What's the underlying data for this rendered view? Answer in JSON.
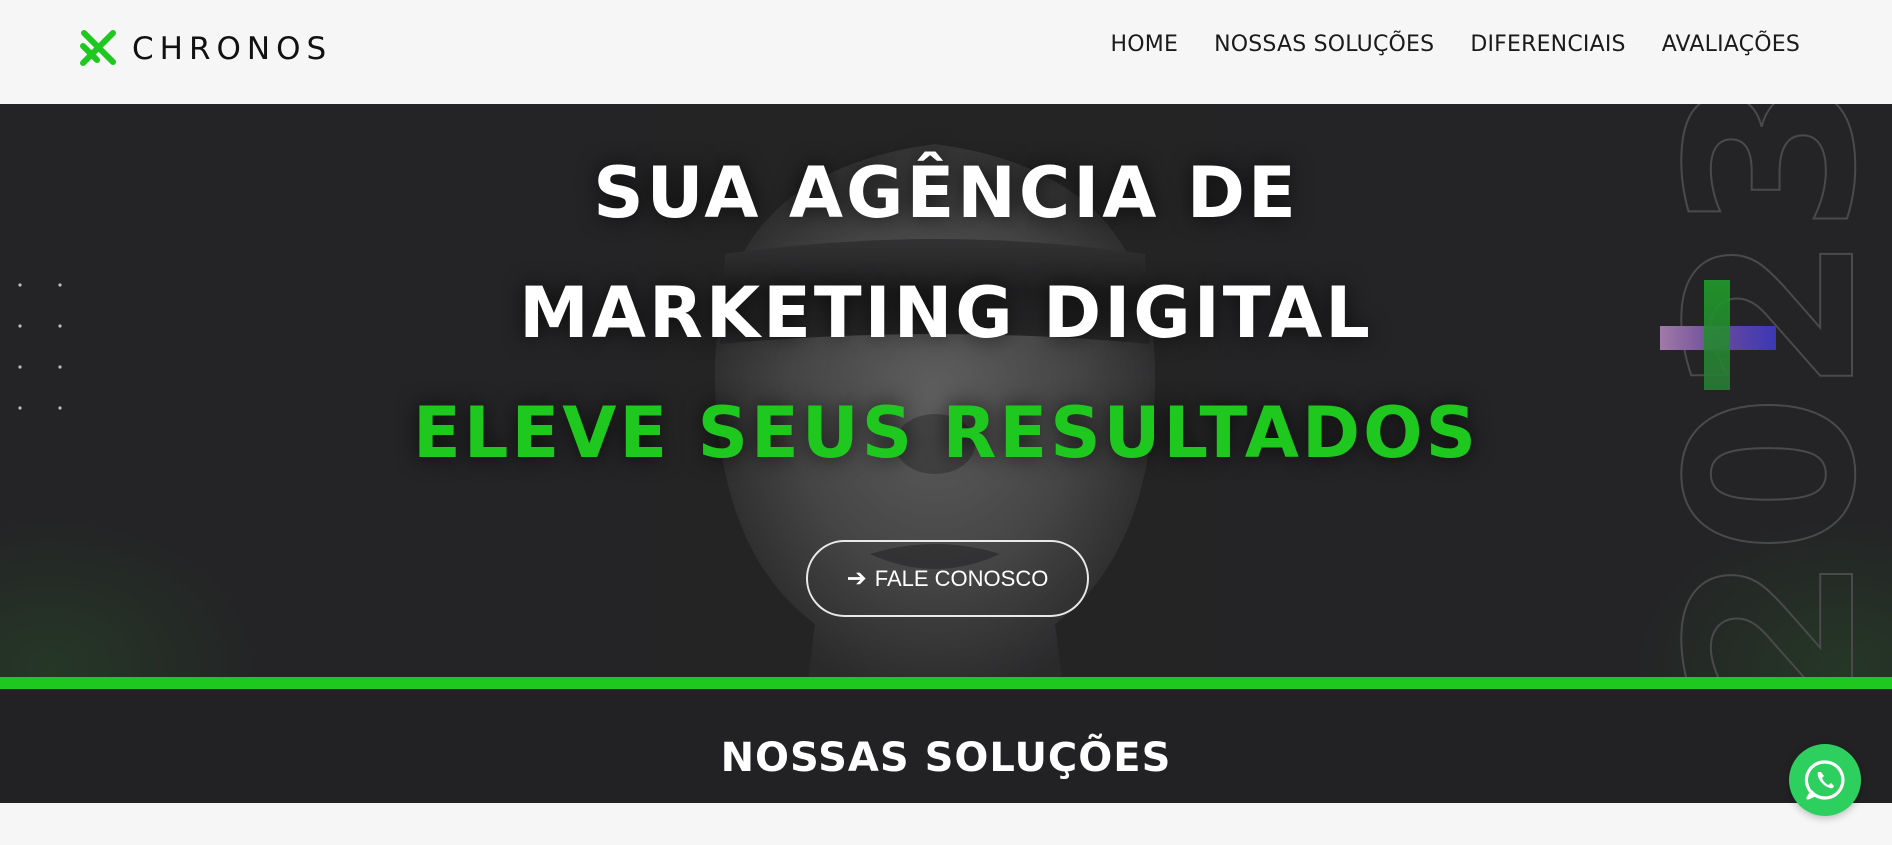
{
  "brand": {
    "name": "CHRONOS",
    "accent": "#1fc81f",
    "logo_icon": "chronos-logo-icon"
  },
  "nav": {
    "items": [
      "HOME",
      "NOSSAS SOLUÇÕES",
      "DIFERENCIAIS",
      "AVALIAÇÕES"
    ]
  },
  "hero": {
    "line1": "SUA AGÊNCIA DE",
    "line2": "MARKETING DIGITAL",
    "line3": "ELEVE SEUS RESULTADOS",
    "cta_label": "FALE CONOSCO",
    "cta_icon": "arrow-right-icon",
    "year_text": "2023",
    "background": "#242426"
  },
  "solutions": {
    "title": "NOSSAS SOLUÇÕES"
  },
  "floating": {
    "whatsapp_icon": "whatsapp-icon",
    "color": "#2dd05f"
  }
}
